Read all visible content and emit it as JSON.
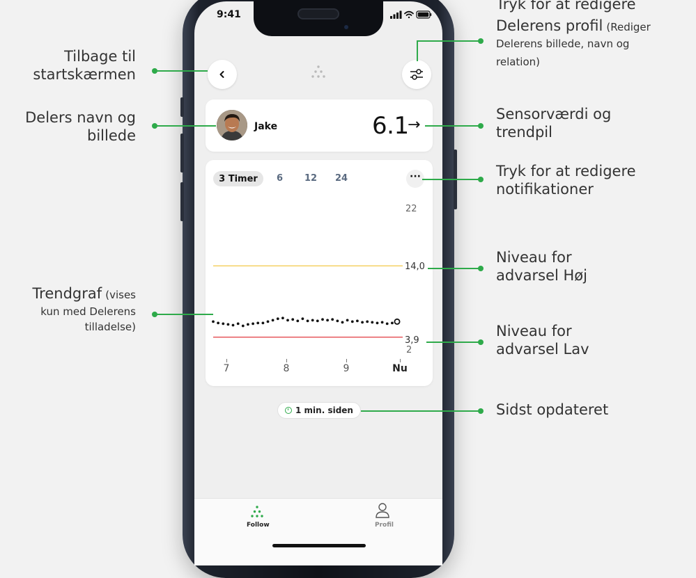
{
  "status": {
    "time": "9:41"
  },
  "sharer": {
    "name": "Jake",
    "glucose": "6.1",
    "trend_arrow": "→"
  },
  "chart_controls": {
    "ranges": [
      "3 Timer",
      "6",
      "12",
      "24"
    ],
    "more": "···"
  },
  "last_updated": "1 min. siden",
  "tabs": [
    {
      "label": "Follow",
      "icon": "follow-dots-icon",
      "active": true
    },
    {
      "label": "Profil",
      "icon": "person-icon",
      "active": false
    }
  ],
  "annotations": {
    "back": [
      "Tilbage til",
      "startskærmen"
    ],
    "sharer": [
      "Delers navn og",
      "billede"
    ],
    "graph_main": "Trendgraf",
    "graph_note_1": "(vises",
    "graph_note_2": "kun med Delerens",
    "graph_note_3": "tilladelse)",
    "edit_profile_1": "Tryk for at redigere",
    "edit_profile_2": "Delerens profil",
    "edit_profile_note_1": "(Rediger",
    "edit_profile_note_2": "Delerens billede, navn og",
    "edit_profile_note_3": "relation)",
    "sensor": [
      "Sensorværdi og",
      "trendpil"
    ],
    "notifications": [
      "Tryk for at redigere",
      "notifikationer"
    ],
    "high": [
      "Niveau for",
      "advarsel Høj"
    ],
    "low": [
      "Niveau for",
      "advarsel Lav"
    ],
    "updated": "Sidst opdateret"
  },
  "colors": {
    "accent_green": "#2eaa4a",
    "high_line": "#f2c230",
    "low_line": "#e0383e"
  },
  "chart_data": {
    "type": "scatter",
    "x_ticks": [
      "7",
      "8",
      "9",
      "Nu"
    ],
    "y_ticks": [
      "22",
      "14,0",
      "3,9",
      "2"
    ],
    "ylim": [
      2,
      22
    ],
    "threshold_high": 14.0,
    "threshold_low": 3.9,
    "values": [
      6.1,
      5.9,
      5.8,
      5.7,
      5.6,
      5.8,
      5.5,
      5.7,
      5.8,
      5.9,
      5.9,
      6.1,
      6.3,
      6.5,
      6.6,
      6.3,
      6.4,
      6.2,
      6.5,
      6.2,
      6.3,
      6.2,
      6.4,
      6.3,
      6.4,
      6.2,
      6.0,
      6.3,
      6.1,
      6.2,
      6.0,
      6.1,
      6.0,
      5.9,
      6.0,
      5.8,
      5.9,
      6.1
    ]
  }
}
